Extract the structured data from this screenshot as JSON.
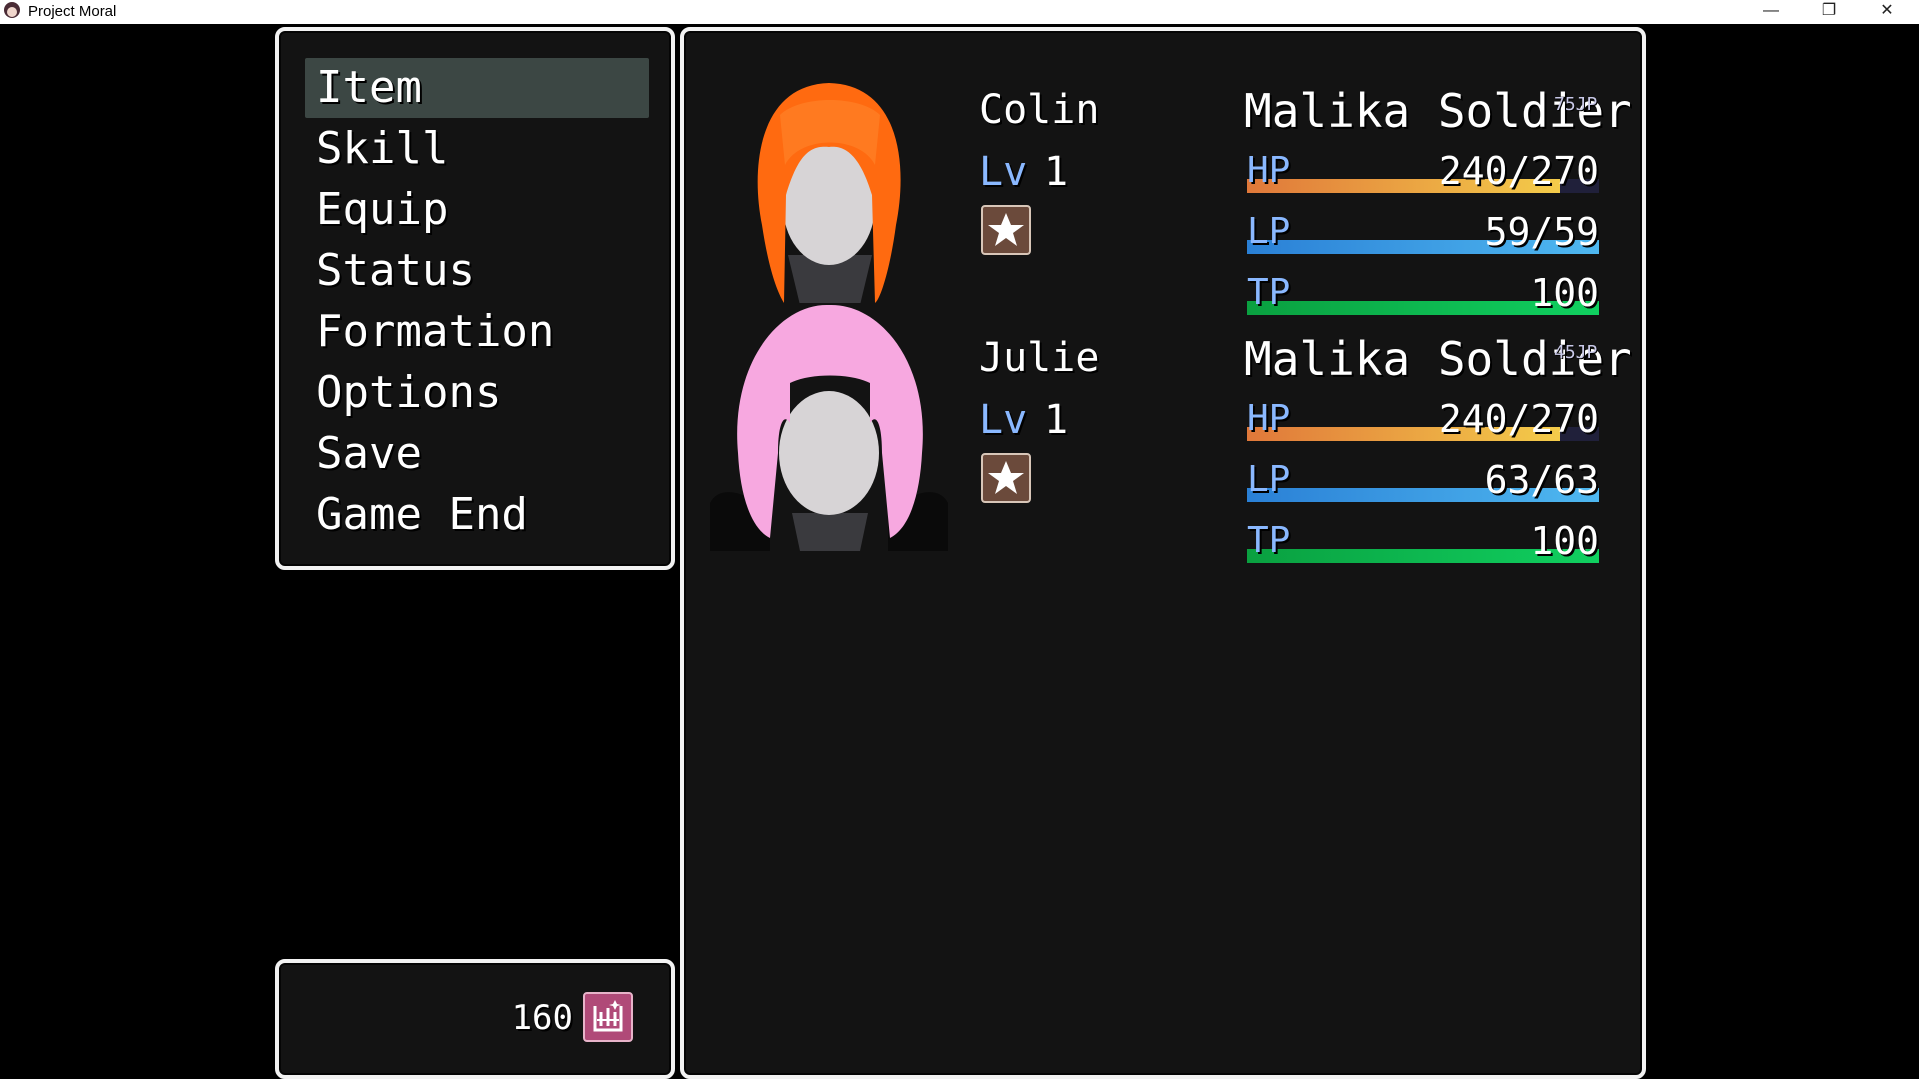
{
  "window": {
    "title": "Project Moral",
    "minimize_glyph": "—",
    "maximize_glyph": "❐",
    "close_glyph": "✕"
  },
  "menu": {
    "items": [
      {
        "label": "Item",
        "selected": true
      },
      {
        "label": "Skill",
        "selected": false
      },
      {
        "label": "Equip",
        "selected": false
      },
      {
        "label": "Status",
        "selected": false
      },
      {
        "label": "Formation",
        "selected": false
      },
      {
        "label": "Options",
        "selected": false
      },
      {
        "label": "Save",
        "selected": false
      },
      {
        "label": "Game End",
        "selected": false
      }
    ]
  },
  "gold": {
    "value": "160",
    "icon": "gold-icon"
  },
  "actors": [
    {
      "name": "Colin",
      "level_label": "Lv",
      "level": "1",
      "class": "Malika Soldier",
      "jp": "75JP",
      "hair_color": "#ff6a10",
      "state_icon": "star-icon",
      "hp": {
        "label": "HP",
        "text": "240/270",
        "ratio": 0.889
      },
      "lp": {
        "label": "LP",
        "text": "59/59",
        "ratio": 1.0
      },
      "tp": {
        "label": "TP",
        "text": "100",
        "ratio": 1.0
      }
    },
    {
      "name": "Julie",
      "level_label": "Lv",
      "level": "1",
      "class": "Malika Soldier",
      "jp": "45JP",
      "hair_color": "#f7a8e0",
      "state_icon": "star-icon",
      "hp": {
        "label": "HP",
        "text": "240/270",
        "ratio": 0.889
      },
      "lp": {
        "label": "LP",
        "text": "63/63",
        "ratio": 1.0
      },
      "tp": {
        "label": "TP",
        "text": "100",
        "ratio": 1.0
      }
    }
  ]
}
